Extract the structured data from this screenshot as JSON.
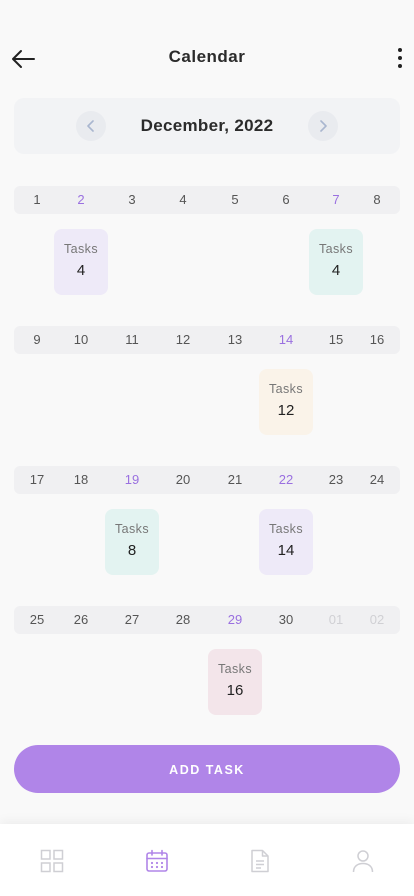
{
  "header": {
    "title": "Calendar"
  },
  "month": {
    "label": "December, 2022"
  },
  "weeks": [
    {
      "days": [
        {
          "label": "1",
          "style": "normal"
        },
        {
          "label": "2",
          "style": "purple"
        },
        {
          "label": "3",
          "style": "normal"
        },
        {
          "label": "4",
          "style": "normal"
        },
        {
          "label": "5",
          "style": "normal"
        },
        {
          "label": "6",
          "style": "normal"
        },
        {
          "label": "7",
          "style": "purple"
        },
        {
          "label": "8",
          "style": "normal"
        }
      ],
      "tasks": [
        {
          "day": "2",
          "label": "Tasks",
          "count": "4",
          "color": "#eeeaf8"
        },
        {
          "day": "7",
          "label": "Tasks",
          "count": "4",
          "color": "#e3f3f1"
        }
      ]
    },
    {
      "days": [
        {
          "label": "9",
          "style": "normal"
        },
        {
          "label": "10",
          "style": "normal"
        },
        {
          "label": "11",
          "style": "normal"
        },
        {
          "label": "12",
          "style": "normal"
        },
        {
          "label": "13",
          "style": "normal"
        },
        {
          "label": "14",
          "style": "purple"
        },
        {
          "label": "15",
          "style": "normal"
        },
        {
          "label": "16",
          "style": "normal"
        }
      ],
      "tasks": [
        {
          "day": "14",
          "label": "Tasks",
          "count": "12",
          "color": "#faf3e9"
        }
      ]
    },
    {
      "days": [
        {
          "label": "17",
          "style": "normal"
        },
        {
          "label": "18",
          "style": "normal"
        },
        {
          "label": "19",
          "style": "purple"
        },
        {
          "label": "20",
          "style": "normal"
        },
        {
          "label": "21",
          "style": "normal"
        },
        {
          "label": "22",
          "style": "purple"
        },
        {
          "label": "23",
          "style": "normal"
        },
        {
          "label": "24",
          "style": "normal"
        }
      ],
      "tasks": [
        {
          "day": "19",
          "label": "Tasks",
          "count": "8",
          "color": "#e3f3f1"
        },
        {
          "day": "22",
          "label": "Tasks",
          "count": "14",
          "color": "#eeeaf8"
        }
      ]
    },
    {
      "days": [
        {
          "label": "25",
          "style": "normal"
        },
        {
          "label": "26",
          "style": "normal"
        },
        {
          "label": "27",
          "style": "normal"
        },
        {
          "label": "28",
          "style": "normal"
        },
        {
          "label": "29",
          "style": "purple"
        },
        {
          "label": "30",
          "style": "normal"
        },
        {
          "label": "01",
          "style": "faded"
        },
        {
          "label": "02",
          "style": "faded"
        }
      ],
      "tasks": [
        {
          "day": "29",
          "label": "Tasks",
          "count": "16",
          "color": "#f3e5ea"
        }
      ]
    }
  ],
  "add_task": {
    "label": "ADD TASK"
  },
  "bottom_nav": {
    "items": [
      {
        "icon": "grid-icon",
        "active": false
      },
      {
        "icon": "calendar-icon",
        "active": true
      },
      {
        "icon": "document-icon",
        "active": false
      },
      {
        "icon": "profile-icon",
        "active": false
      }
    ]
  },
  "colors": {
    "accent": "#b085e8",
    "accent_text": "#9a70e0",
    "inactive_icon": "#cfcfd4"
  }
}
